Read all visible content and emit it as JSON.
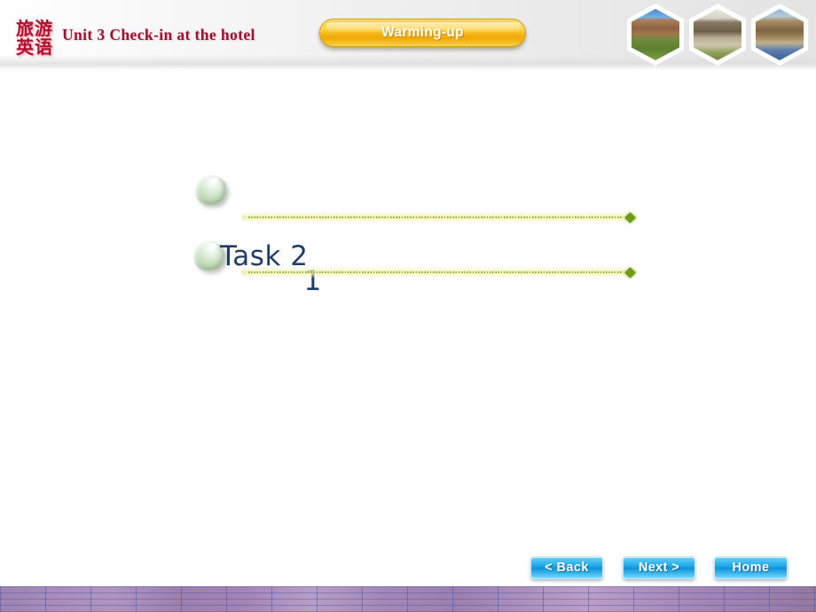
{
  "header": {
    "course_logo_line1": "旅游",
    "course_logo_line2": "英语",
    "unit_title": "Unit 3 Check-in  at the hotel",
    "section_pill_label": "Warming-up",
    "thumbnails": [
      {
        "name": "campus-building-photo"
      },
      {
        "name": "clock-tower-photo"
      },
      {
        "name": "street-buildings-photo"
      }
    ]
  },
  "body": {
    "bullets": [
      {
        "label": ""
      },
      {
        "label": "Task 2",
        "overlap_digit": "1"
      }
    ],
    "task_label": "Task 2",
    "task_overlap_digit": "1"
  },
  "nav": {
    "back_label": "< Back",
    "next_label": "Next >",
    "home_label": "Home"
  },
  "colors": {
    "accent_gold": "#f5b81d",
    "title_red": "#9e1030",
    "task_blue": "#1f3d66",
    "nav_blue": "#1ea7e8",
    "rule_olive": "#9aa832",
    "footer_purple": "#a98cbb"
  }
}
